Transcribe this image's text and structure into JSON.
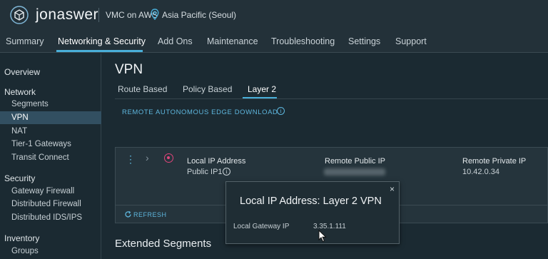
{
  "header": {
    "brand": "jonaswer",
    "org_name": "VMC on AWS",
    "region": "Asia Pacific (Seoul)",
    "logo_icon": "vmc-cube-icon",
    "region_icon": "map-pin-icon"
  },
  "nav": {
    "tabs": [
      {
        "label": "Summary"
      },
      {
        "label": "Networking & Security"
      },
      {
        "label": "Add Ons"
      },
      {
        "label": "Maintenance"
      },
      {
        "label": "Troubleshooting"
      },
      {
        "label": "Settings"
      },
      {
        "label": "Support"
      }
    ],
    "active": "Networking & Security"
  },
  "sidebar": {
    "overview": "Overview",
    "network_head": "Network",
    "network_items": [
      "Segments",
      "VPN",
      "NAT",
      "Tier-1 Gateways",
      "Transit Connect"
    ],
    "security_head": "Security",
    "security_items": [
      "Gateway Firewall",
      "Distributed Firewall",
      "Distributed IDS/IPS"
    ],
    "inventory_head": "Inventory",
    "inventory_items": [
      "Groups"
    ],
    "active": "VPN"
  },
  "main": {
    "title": "VPN",
    "subtabs": [
      {
        "label": "Route Based"
      },
      {
        "label": "Policy Based"
      },
      {
        "label": "Layer 2"
      }
    ],
    "active_subtab": "Layer 2",
    "remote_download_link": "REMOTE AUTONOMOUS EDGE DOWNLOAD",
    "vpn_card": {
      "columns": [
        {
          "header": "Local IP Address",
          "value": "Public IP1"
        },
        {
          "header": "Remote Public IP",
          "value": ""
        },
        {
          "header": "Remote Private IP",
          "value": "10.42.0.34"
        }
      ],
      "refresh_label": "REFRESH"
    },
    "extended_segments_title": "Extended Segments"
  },
  "popover": {
    "title": "Local IP Address: Layer 2 VPN",
    "field_label": "Local Gateway IP",
    "field_value": "3.35.1.111",
    "close_symbol": "×"
  },
  "colors": {
    "accent": "#49afd9",
    "link": "#5eb6dd",
    "vpn_icon": "#e0457b",
    "background": "#1b2a32",
    "header": "#233139"
  }
}
